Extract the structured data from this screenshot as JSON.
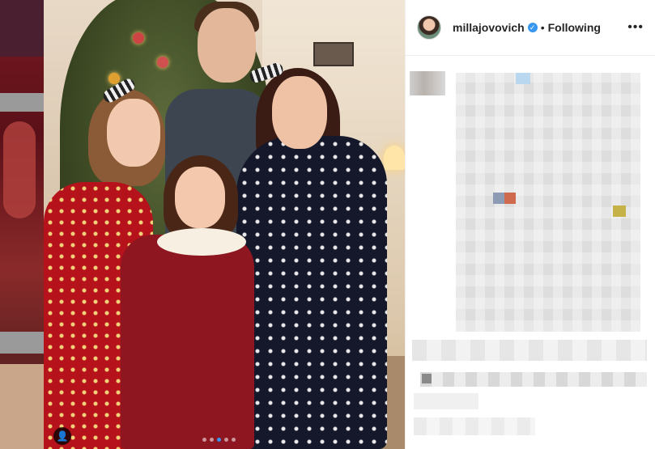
{
  "post": {
    "username": "millajovovich",
    "separator": "•",
    "follow_status": "Following",
    "more_icon": "•••",
    "verified_icon": "✓",
    "user_tag_icon": "👤"
  },
  "carousel": {
    "count": 5,
    "active_index": 2
  },
  "colors": {
    "accent_blue": "#3897f0",
    "text_primary": "#262626",
    "border": "#efefef"
  }
}
